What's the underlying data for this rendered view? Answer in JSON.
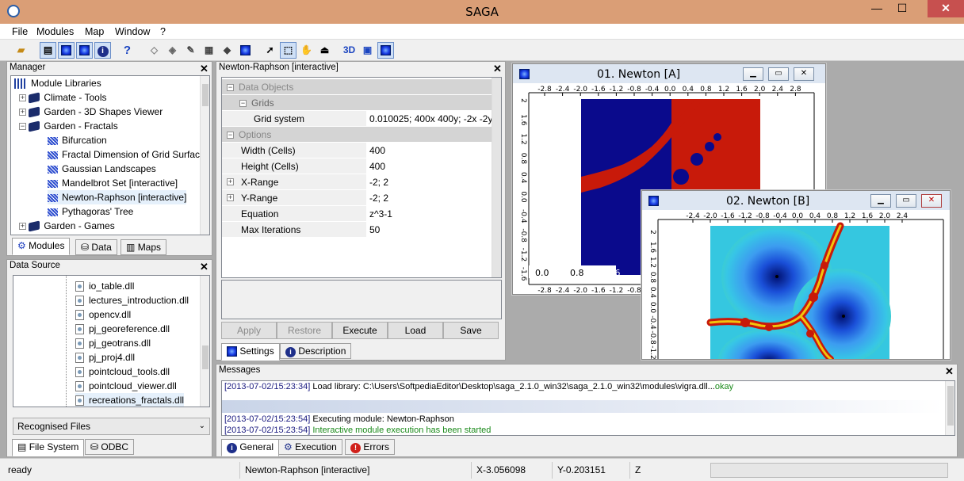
{
  "window": {
    "title": "SAGA",
    "min": "—",
    "max": "☐",
    "close": "✕"
  },
  "menu": [
    "File",
    "Modules",
    "Map",
    "Window",
    "?"
  ],
  "manager": {
    "title": "Manager",
    "items": [
      {
        "label": "Module Libraries"
      },
      {
        "label": "Climate - Tools"
      },
      {
        "label": "Garden - 3D Shapes Viewer"
      },
      {
        "label": "Garden - Fractals"
      },
      {
        "label": "Bifurcation"
      },
      {
        "label": "Fractal Dimension of Grid Surface"
      },
      {
        "label": "Gaussian Landscapes"
      },
      {
        "label": "Mandelbrot Set [interactive]"
      },
      {
        "label": "Newton-Raphson [interactive]"
      },
      {
        "label": "Pythagoras' Tree"
      },
      {
        "label": "Garden - Games"
      }
    ],
    "tabs": [
      "Modules",
      "Data",
      "Maps"
    ]
  },
  "datasource": {
    "title": "Data Source",
    "files": [
      "io_table.dll",
      "lectures_introduction.dll",
      "opencv.dll",
      "pj_georeference.dll",
      "pj_geotrans.dll",
      "pj_proj4.dll",
      "pointcloud_tools.dll",
      "pointcloud_viewer.dll",
      "recreations_fractals.dll"
    ],
    "filter": "Recognised Files",
    "tabs": [
      "File System",
      "ODBC"
    ]
  },
  "settings": {
    "title": "Newton-Raphson [interactive]",
    "sections": {
      "data_objects": "Data Objects",
      "grids": "Grids",
      "options": "Options"
    },
    "grid_system": {
      "label": "Grid system",
      "value": "0.010025; 400x 400y; -2x -2y"
    },
    "rows": [
      {
        "label": "Width (Cells)",
        "value": "400"
      },
      {
        "label": "Height (Cells)",
        "value": "400"
      },
      {
        "label": "X-Range",
        "value": "-2; 2"
      },
      {
        "label": "Y-Range",
        "value": "-2; 2"
      },
      {
        "label": "Equation",
        "value": "z^3-1"
      },
      {
        "label": "Max Iterations",
        "value": "50"
      }
    ],
    "buttons": {
      "apply": "Apply",
      "restore": "Restore",
      "execute": "Execute",
      "load": "Load",
      "save": "Save"
    },
    "tabs": [
      "Settings",
      "Description"
    ]
  },
  "map1": {
    "title": "01. Newton [A]",
    "xticks": [
      "-2.8",
      "-2.4",
      "-2.0",
      "-1.6",
      "-1.2",
      "-0.8",
      "-0.4",
      "0.0",
      "0.4",
      "0.8",
      "1.2",
      "1.6",
      "2.0",
      "2.4",
      "2.8"
    ],
    "yticks": [
      "2",
      "1.6",
      "1.2",
      "0.8",
      "0.4",
      "0.0",
      "-0.4",
      "-0.8",
      "-1.2",
      "-1.6"
    ],
    "bottom_labels": [
      "0.0",
      "0.8",
      "1.6"
    ]
  },
  "map2": {
    "title": "02. Newton [B]",
    "xticks": [
      "-2.4",
      "-2.0",
      "-1.6",
      "-1.2",
      "-0.8",
      "-0.4",
      "0.0",
      "0.4",
      "0.8",
      "1.2",
      "1.6",
      "2.0",
      "2.4"
    ],
    "yticks": [
      "2",
      "1.6",
      "1.2",
      "0.8",
      "0.4",
      "0.0",
      "-0.4",
      "-0.8",
      "-1.2"
    ]
  },
  "messages": {
    "title": "Messages",
    "lines": [
      {
        "ts": "[2013-07-02/15:23:34]",
        "text": "Load library: C:\\Users\\SoftpediaEditor\\Desktop\\saga_2.1.0_win32\\saga_2.1.0_win32\\modules\\vigra.dll...",
        "ok": "okay"
      },
      {
        "ts": "[2013-07-02/15:23:54]",
        "text": "Executing module: Newton-Raphson",
        "ok": ""
      },
      {
        "ts": "[2013-07-02/15:23:54]",
        "text": "",
        "ok": "Interactive module execution has been started"
      }
    ],
    "tabs": [
      "General",
      "Execution",
      "Errors"
    ]
  },
  "status": {
    "ready": "ready",
    "module": "Newton-Raphson [interactive]",
    "x": "X-3.056098",
    "y": "Y-0.203151",
    "z": "Z"
  },
  "colors": {
    "accent": "#DA9E76",
    "basin_blue": "#0A0A8C",
    "basin_red": "#C81A0A"
  }
}
